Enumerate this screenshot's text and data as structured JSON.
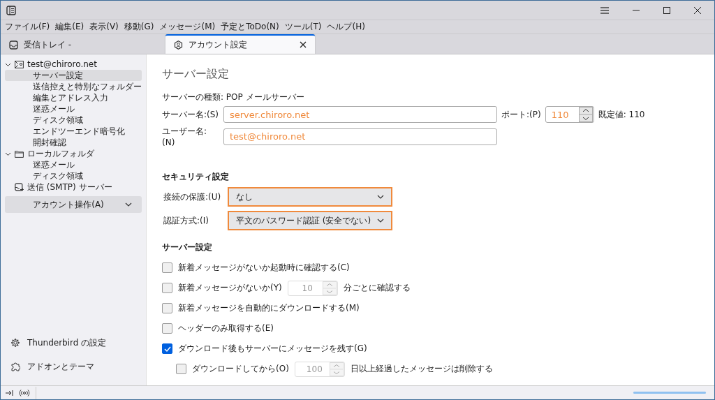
{
  "menu": [
    "ファイル(F)",
    "編集(E)",
    "表示(V)",
    "移動(G)",
    "メッセージ(M)",
    "予定とToDo(N)",
    "ツール(T)",
    "ヘルプ(H)"
  ],
  "tabs": [
    {
      "label": "受信トレイ -",
      "selected": false,
      "kind": "mail"
    },
    {
      "label": "アカウント設定",
      "selected": true,
      "kind": "account"
    }
  ],
  "sidebar": {
    "tree": [
      {
        "label": "test@chiroro.net",
        "kind": "account",
        "expanded": true,
        "children": [
          {
            "label": "サーバー設定",
            "selected": true
          },
          {
            "label": "送信控えと特別なフォルダー",
            "selected": false
          },
          {
            "label": "編集とアドレス入力",
            "selected": false
          },
          {
            "label": "迷惑メール",
            "selected": false
          },
          {
            "label": "ディスク領域",
            "selected": false
          },
          {
            "label": "エンドツーエンド暗号化",
            "selected": false
          },
          {
            "label": "開封確認",
            "selected": false
          }
        ]
      },
      {
        "label": "ローカルフォルダ",
        "kind": "folder",
        "expanded": true,
        "children": [
          {
            "label": "迷惑メール",
            "selected": false
          },
          {
            "label": "ディスク領域",
            "selected": false
          }
        ]
      },
      {
        "label": "送信 (SMTP) サーバー",
        "kind": "smtp"
      }
    ],
    "account_actions": "アカウント操作(A)",
    "footer": [
      {
        "label": "Thunderbird の設定",
        "kind": "settings"
      },
      {
        "label": "アドオンとテーマ",
        "kind": "addons"
      }
    ]
  },
  "content": {
    "title": "サーバー設定",
    "server_type": "サーバーの種類: POP メールサーバー",
    "server_name": {
      "label": "サーバー名:(S)",
      "value": "server.chiroro.net",
      "highlighted": true
    },
    "port": {
      "label": "ポート:(P)",
      "value": "110",
      "highlighted": true,
      "default": "既定値: 110"
    },
    "user_name": {
      "label": "ユーザー名:(N)",
      "value": "test@chiroro.net",
      "highlighted": true
    },
    "security_heading": "セキュリティ設定",
    "selects": [
      {
        "label": "接続の保護:(U)",
        "value": "なし",
        "highlighted": true
      },
      {
        "label": "認証方式:(I)",
        "value": "平文のパスワード認証 (安全でない)",
        "highlighted": true
      }
    ],
    "server_heading": "サーバー設定",
    "options": [
      {
        "kind": "plain",
        "label": "新着メッセージがないか起動時に確認する(C)",
        "checked": false
      },
      {
        "kind": "spin",
        "label": "新着メッセージがないか(Y)",
        "value": "10",
        "suffix": "分ごとに確認する",
        "checked": false,
        "disabled": true
      },
      {
        "kind": "plain",
        "label": "新着メッセージを自動的にダウンロードする(M)",
        "checked": false
      },
      {
        "kind": "plain",
        "label": "ヘッダーのみ取得する(E)",
        "checked": false
      },
      {
        "kind": "plain",
        "label": "ダウンロード後もサーバーにメッセージを残す(G)",
        "checked": true,
        "children": [
          {
            "kind": "spin",
            "label": "ダウンロードしてから(O)",
            "value": "100",
            "suffix": "日以上経過したメッセージは削除する",
            "checked": false,
            "disabled": true
          }
        ]
      }
    ]
  },
  "status_bar": {
    "progress": {
      "level": 1
    }
  }
}
